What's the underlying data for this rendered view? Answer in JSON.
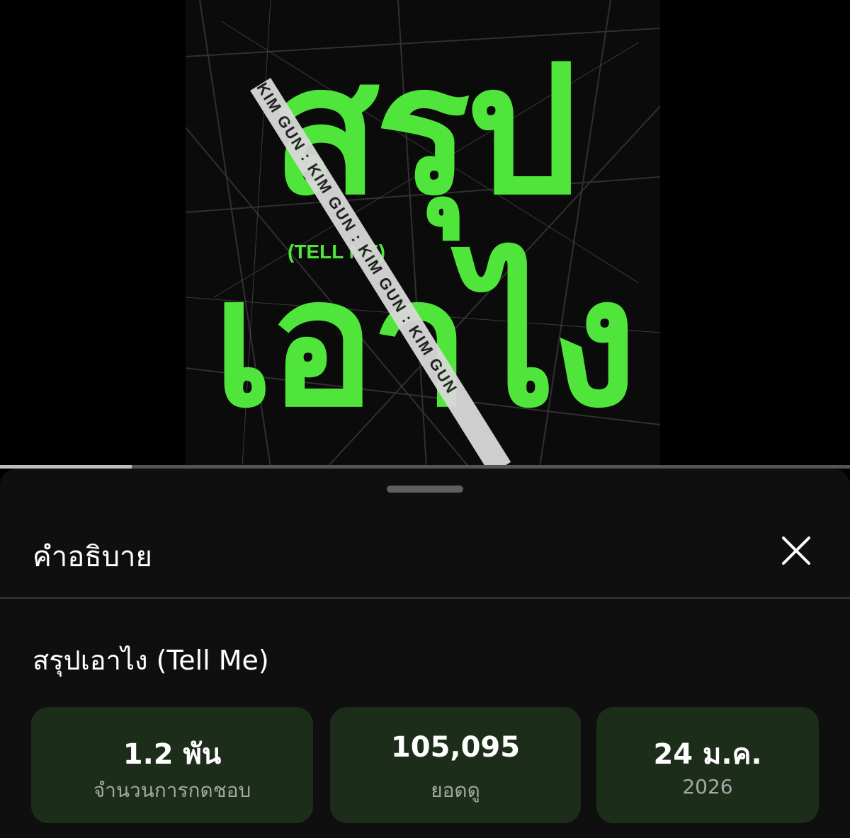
{
  "video": {
    "thumbnail": {
      "title_line1": "สรุป",
      "title_line2": "เอาไง",
      "subtitle": "(TELL ME)",
      "tape_text": "KIM GUN  :  KIM GUN  :  KIM GUN  :  KIM GUN",
      "accent_color": "#4fe53a"
    },
    "progress_fraction": 0.155
  },
  "sheet": {
    "title": "คำอธิบาย",
    "close_icon": "close-icon",
    "video_title": "สรุปเอาไง (Tell Me)",
    "stats": {
      "likes": {
        "value": "1.2 พัน",
        "label": "จำนวนการกดชอบ"
      },
      "views": {
        "value": "105,095",
        "label": "ยอดดู"
      },
      "date": {
        "value": "24 ม.ค.",
        "label": "2026"
      }
    },
    "card_color": "#1c2d1a"
  }
}
